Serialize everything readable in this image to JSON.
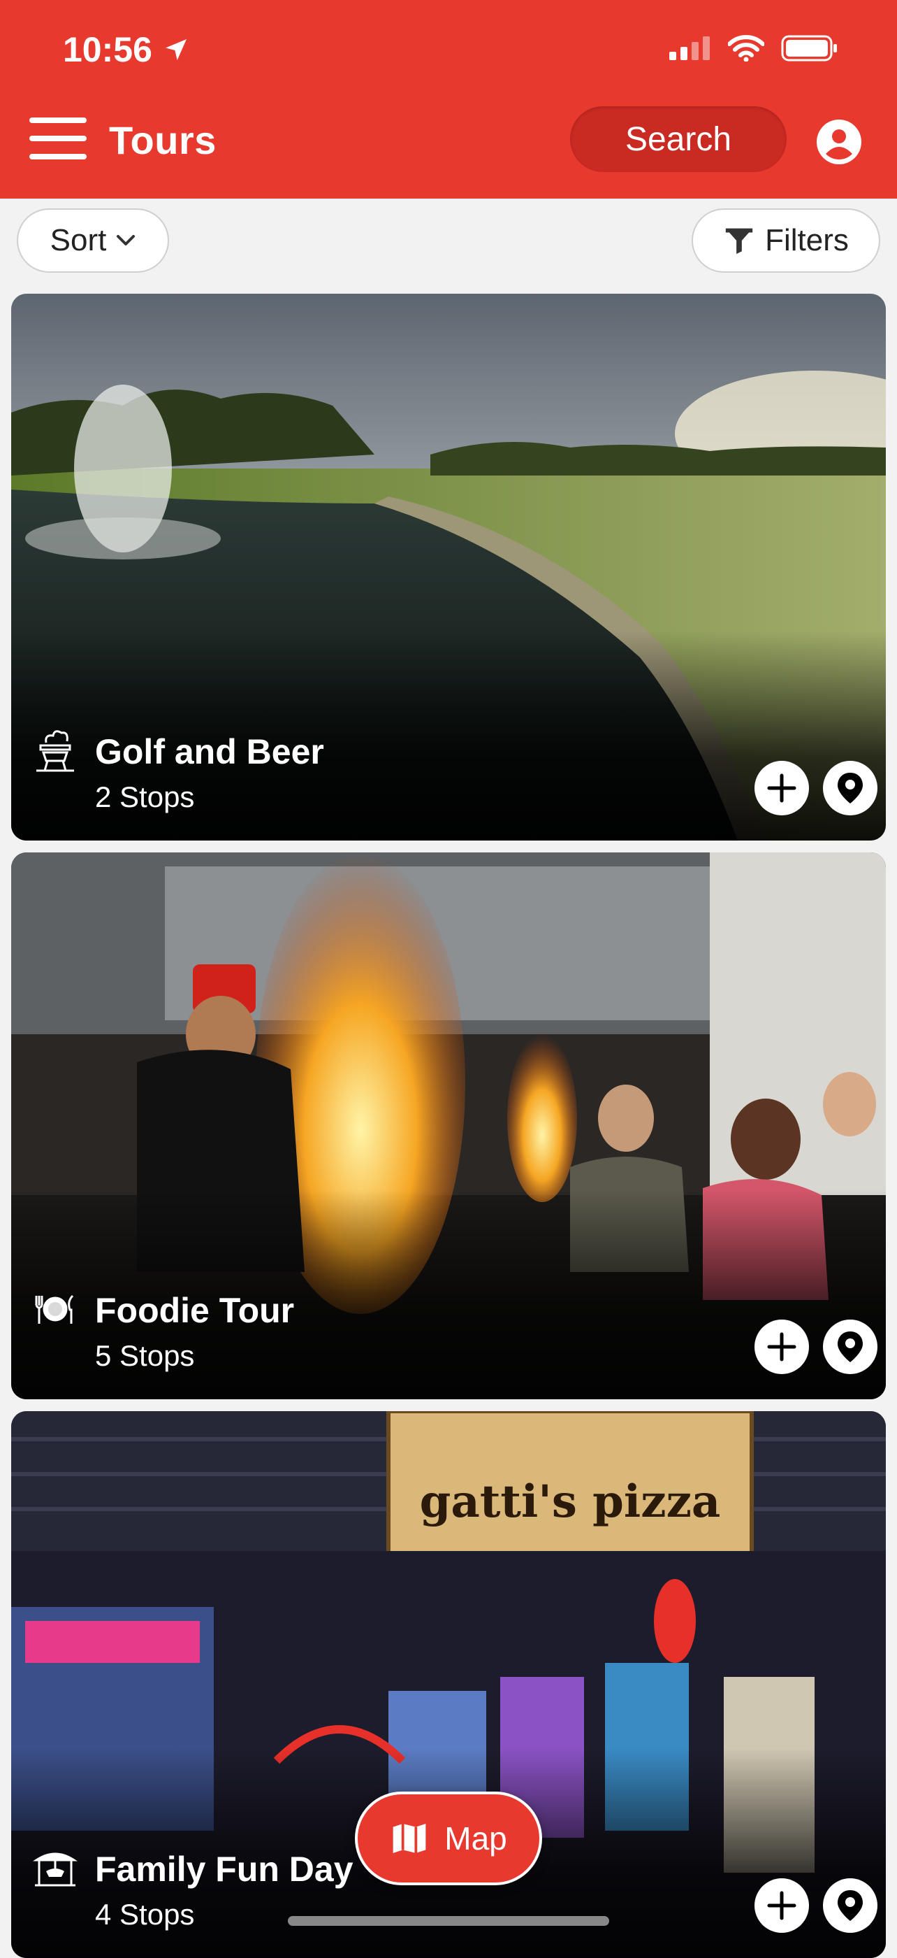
{
  "status_bar": {
    "time": "10:56"
  },
  "header": {
    "title": "Tours",
    "search_label": "Search"
  },
  "toolbar": {
    "sort_label": "Sort",
    "filters_label": "Filters"
  },
  "tours": [
    {
      "title": "Golf and Beer",
      "stops": "2 Stops",
      "icon": "barbecue-icon"
    },
    {
      "title": "Foodie Tour",
      "stops": "5 Stops",
      "icon": "plate-cutlery-icon"
    },
    {
      "title": "Family Fun Day",
      "stops": "4 Stops",
      "icon": "carousel-icon"
    }
  ],
  "card_image_text": {
    "sign": "gatti's pizza"
  },
  "map_button": {
    "label": "Map"
  },
  "colors": {
    "brand": "#e8392e",
    "brand_dark": "#c92a22"
  }
}
